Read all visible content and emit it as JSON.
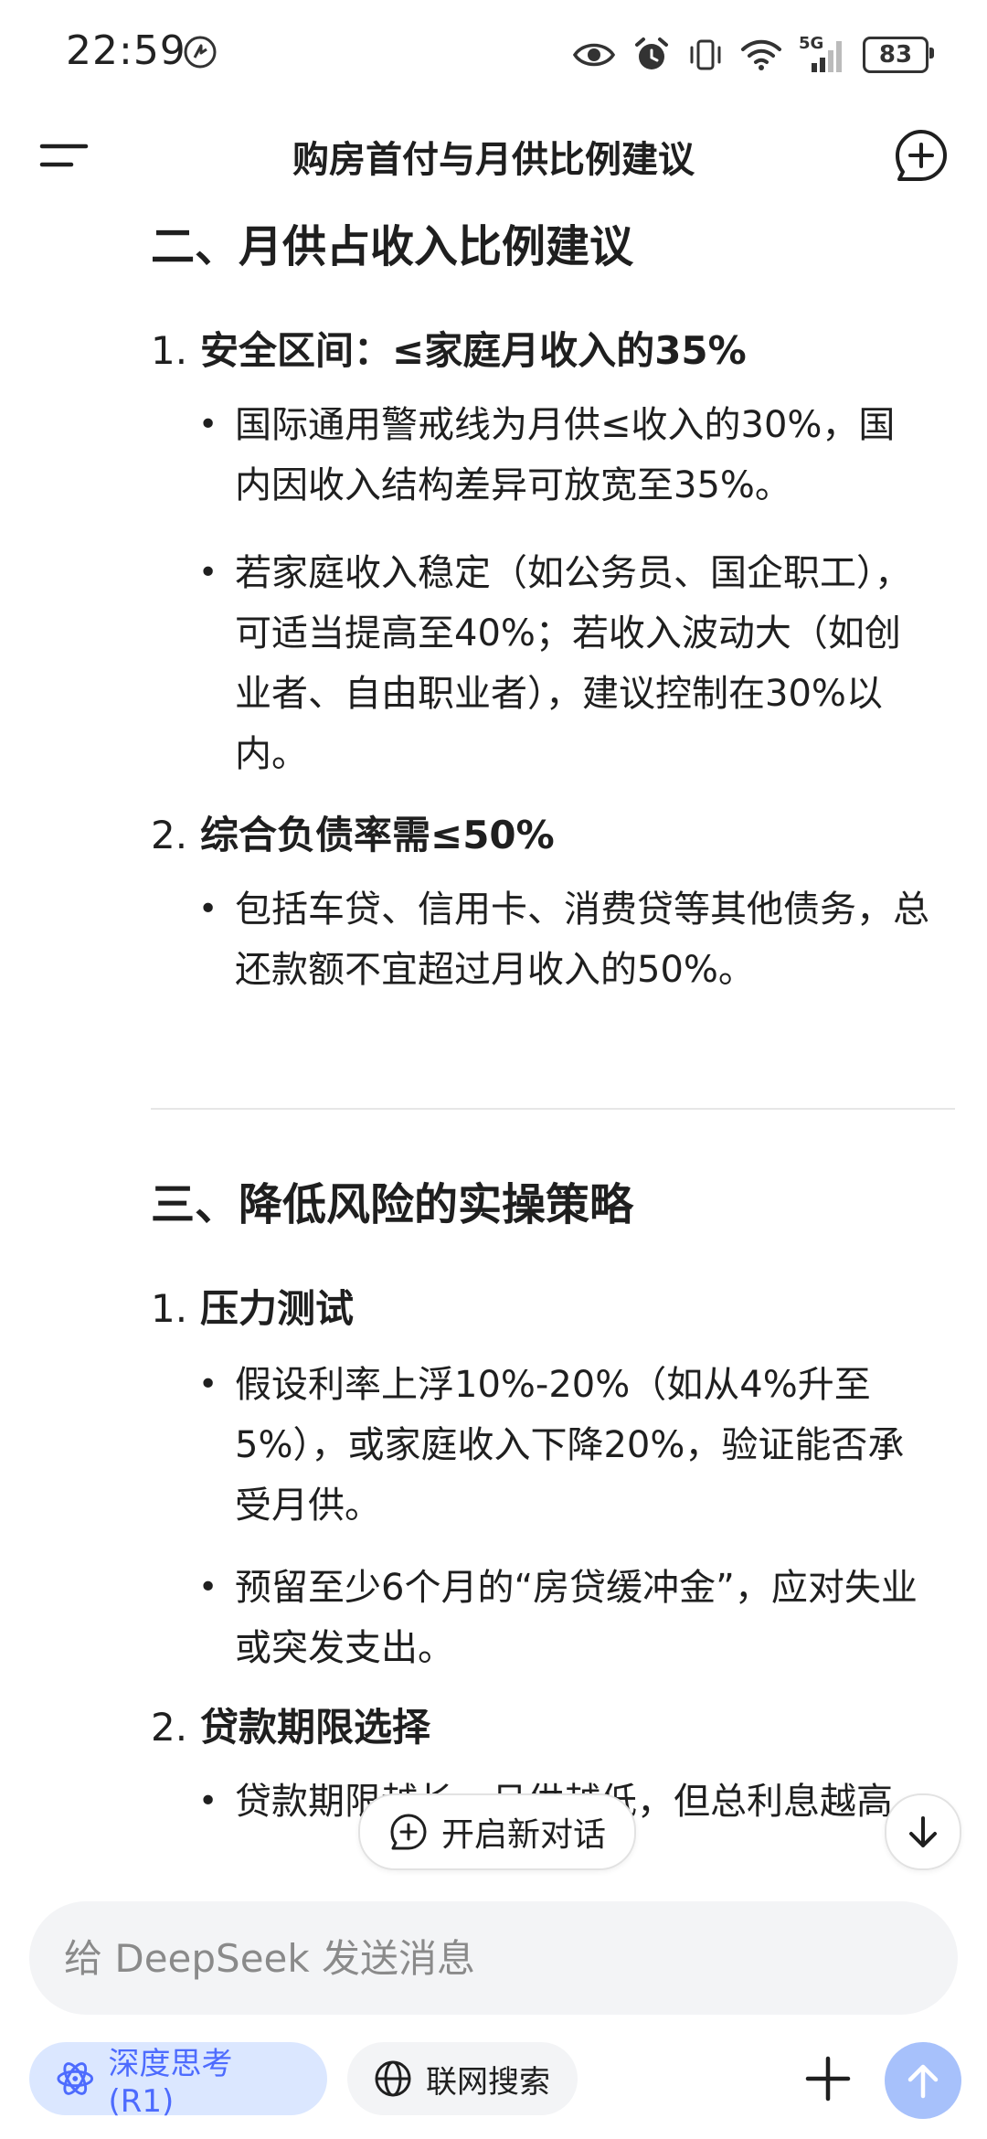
{
  "status_bar": {
    "time": "22:59",
    "battery": "83",
    "network": "5G"
  },
  "header": {
    "title": "购房首付与月供比例建议"
  },
  "content": {
    "section2_title": "二、月供占收入比例建议",
    "s2_item1_num": "1.",
    "s2_item1_text": "安全区间：≤家庭月收入的35%",
    "s2_item1_b1": "国际通用警戒线为月供≤收入的30%，国内因收入结构差异可放宽至35%。",
    "s2_item1_b2": "若家庭收入稳定（如公务员、国企职工），可适当提高至40%；若收入波动大（如创业者、自由职业者），建议控制在30%以内。",
    "s2_item2_num": "2.",
    "s2_item2_text": "综合负债率需≤50%",
    "s2_item2_b1": "包括车贷、信用卡、消费贷等其他债务，总还款额不宜超过月收入的50%。",
    "section3_title": "三、降低风险的实操策略",
    "s3_item1_num": "1.",
    "s3_item1_text": "压力测试",
    "s3_item1_b1": "假设利率上浮10%-20%（如从4%升至5%），或家庭收入下降20%，验证能否承受月供。",
    "s3_item1_b2": "预留至少6个月的“房贷缓冲金”，应对失业或突发支出。",
    "s3_item2_num": "2.",
    "s3_item2_text": "贷款期限选择",
    "s3_item2_b1": "贷款期限越长，月供越低，但总利息越高"
  },
  "floating": {
    "start_new_chat": "开启新对话"
  },
  "input": {
    "placeholder": "给 DeepSeek 发送消息"
  },
  "toolbar": {
    "deep_think": "深度思考 (R1)",
    "web_search": "联网搜索"
  },
  "colors": {
    "accent": "#4d6bfe",
    "chip_bg": "#dbe7ff",
    "send_bg": "#a7c1fb"
  }
}
